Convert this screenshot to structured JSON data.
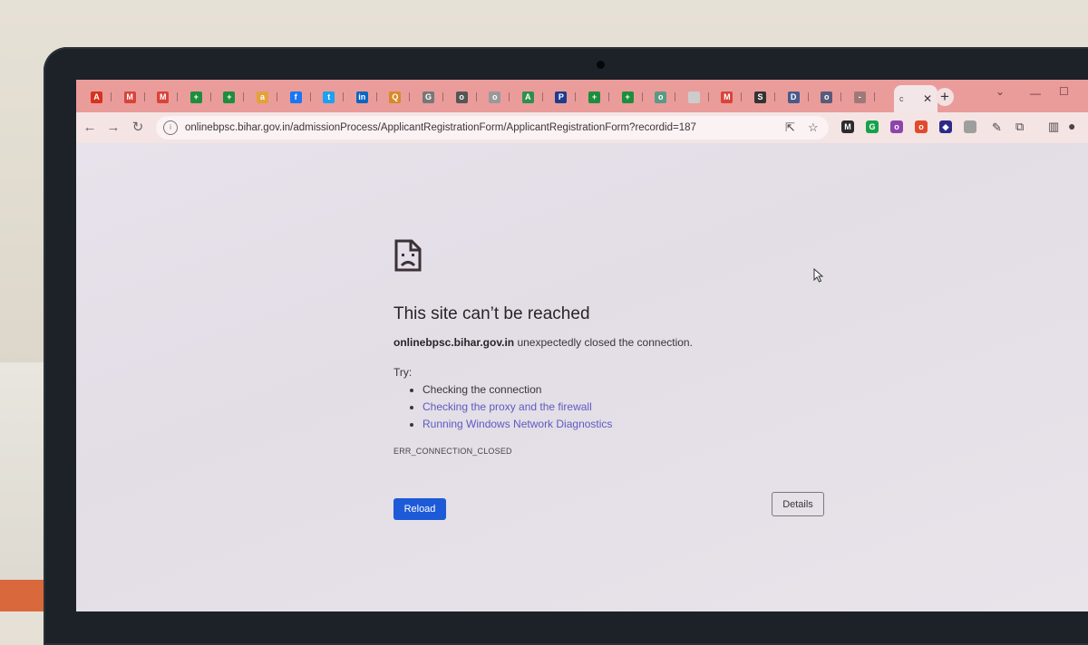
{
  "browser": {
    "tabs": [
      {
        "icon": "adobe-icon",
        "color": "#d6331f",
        "glyph": "A"
      },
      {
        "icon": "gmail-icon",
        "color": "#d9433a",
        "glyph": "M"
      },
      {
        "icon": "gmail-icon",
        "color": "#d9433a",
        "glyph": "M"
      },
      {
        "icon": "sheets-icon",
        "color": "#1e8e3e",
        "glyph": "+"
      },
      {
        "icon": "sheets-icon",
        "color": "#1e8e3e",
        "glyph": "+"
      },
      {
        "icon": "bookmark-icon",
        "color": "#e3a23a",
        "glyph": "a"
      },
      {
        "icon": "facebook-icon",
        "color": "#1877f2",
        "glyph": "f"
      },
      {
        "icon": "twitter-icon",
        "color": "#1da1f2",
        "glyph": "t"
      },
      {
        "icon": "linkedin-icon",
        "color": "#0a66c2",
        "glyph": "in"
      },
      {
        "icon": "search-icon",
        "color": "#d88a2a",
        "glyph": "Q"
      },
      {
        "icon": "google-icon",
        "color": "#777777",
        "glyph": "G"
      },
      {
        "icon": "character-icon",
        "color": "#555555",
        "glyph": "o"
      },
      {
        "icon": "globe-icon",
        "color": "#999999",
        "glyph": "o"
      },
      {
        "icon": "drive-icon",
        "color": "#2f8f4e",
        "glyph": "A"
      },
      {
        "icon": "paypal-icon",
        "color": "#1f3b8f",
        "glyph": "P"
      },
      {
        "icon": "sheets-icon",
        "color": "#1e8e3e",
        "glyph": "+"
      },
      {
        "icon": "sheets-icon",
        "color": "#1e8e3e",
        "glyph": "+"
      },
      {
        "icon": "chatgpt-icon",
        "color": "#5a9a85",
        "glyph": "o"
      },
      {
        "icon": "blank-icon",
        "color": "#cccccc",
        "glyph": ""
      },
      {
        "icon": "gmail-icon",
        "color": "#d9433a",
        "glyph": "M"
      },
      {
        "icon": "skype-icon",
        "color": "#333333",
        "glyph": "S"
      },
      {
        "icon": "docs-icon",
        "color": "#4a5a8a",
        "glyph": "D"
      },
      {
        "icon": "globe-icon",
        "color": "#5a5a7a",
        "glyph": "o"
      },
      {
        "icon": "page-icon",
        "color": "#a07878",
        "glyph": "-"
      }
    ],
    "active_tab": {
      "title": "c"
    },
    "url": "onlinebpsc.bihar.gov.in/admissionProcess/ApplicantRegistrationForm/ApplicantRegistrationForm?recordid=187",
    "extensions": [
      {
        "icon": "m-extension-icon",
        "color": "#2b2b2b",
        "glyph": "M"
      },
      {
        "icon": "grammarly-icon",
        "color": "#15a34a",
        "glyph": "G"
      },
      {
        "icon": "color-extension-icon",
        "color": "#8e44ad",
        "glyph": "o"
      },
      {
        "icon": "record-extension-icon",
        "color": "#e24a2c",
        "glyph": "o"
      },
      {
        "icon": "diamond-extension-icon",
        "color": "#2d2a8c",
        "glyph": "◆"
      },
      {
        "icon": "grey-extension-icon",
        "color": "#9e9e9e",
        "glyph": ""
      }
    ]
  },
  "error_page": {
    "title": "This site can’t be reached",
    "host": "onlinebpsc.bihar.gov.in",
    "description_rest": " unexpectedly closed the connection.",
    "try_label": "Try:",
    "suggestions": [
      {
        "text": "Checking the connection",
        "link": false
      },
      {
        "text": "Checking the proxy and the firewall",
        "link": true
      },
      {
        "text": "Running Windows Network Diagnostics",
        "link": true
      }
    ],
    "error_code": "ERR_CONNECTION_CLOSED",
    "reload_label": "Reload",
    "details_label": "Details"
  }
}
